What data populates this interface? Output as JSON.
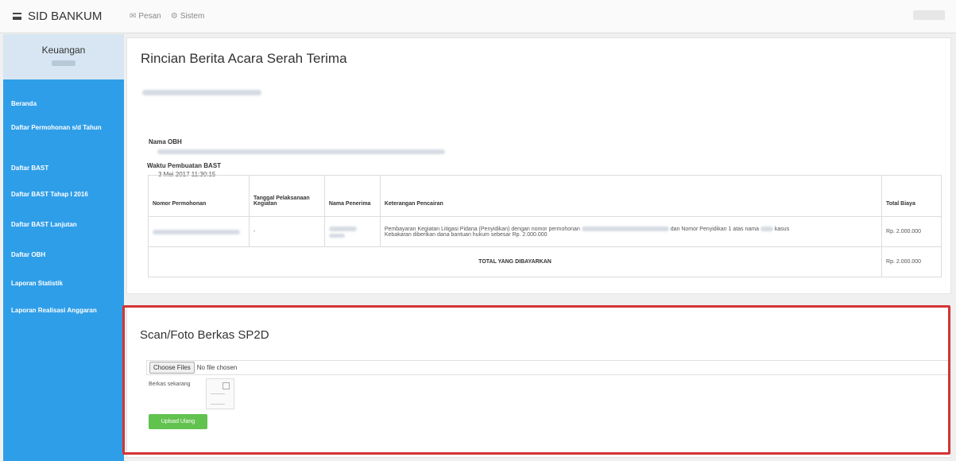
{
  "navbar": {
    "brand": "SID BANKUM",
    "links": [
      {
        "icon": "envelope-icon",
        "glyph": "✉",
        "label": "Pesan"
      },
      {
        "icon": "gear-icon",
        "glyph": "⚙",
        "label": "Sistem"
      }
    ]
  },
  "sidebar": {
    "title": "Keuangan",
    "items": [
      {
        "label": "Beranda"
      },
      {
        "label": "Daftar Permohonan s/d Tahun"
      },
      {
        "label": "Daftar BAST"
      },
      {
        "label": "Daftar BAST Tahap I 2016"
      },
      {
        "label": "Daftar BAST Lanjutan"
      },
      {
        "label": "Daftar OBH"
      },
      {
        "label": "Laporan Statistik"
      },
      {
        "label": "Laporan Realisasi Anggaran"
      }
    ]
  },
  "detail": {
    "title": "Rincian Berita Acara Serah Terima",
    "obh_label": "Nama OBH",
    "time_label": "Waktu Pembuatan BAST",
    "time_value": "3 Mei 2017 11:30:15",
    "table": {
      "headers": [
        "Nomor Permohonan",
        "Tanggal Pelaksanaan Kegiatan",
        "Nama Penerima",
        "Keterangan Pencairan",
        "Total Biaya"
      ],
      "row": {
        "date": "-",
        "description": "Pembayaran Kegiatan Litigasi Pidana (Penyidikan) dengan nomor permohonan",
        "description_mid": "dan Nomor Penyidikan 1 atas nama",
        "description_end": "kasus",
        "description_line2": "Kebakaran diberikan dana bantuan hukum sebesar Rp. 2.000.000",
        "total": "Rp. 2.000.000"
      },
      "total_label": "TOTAL YANG DIBAYARKAN",
      "total_value": "Rp. 2.000.000"
    }
  },
  "upload": {
    "title": "Scan/Foto Berkas SP2D",
    "choose_label": "Choose Files",
    "file_status": "No file chosen",
    "current_label": "Berkas sekarang",
    "upload_button": "Upload Ulang"
  }
}
